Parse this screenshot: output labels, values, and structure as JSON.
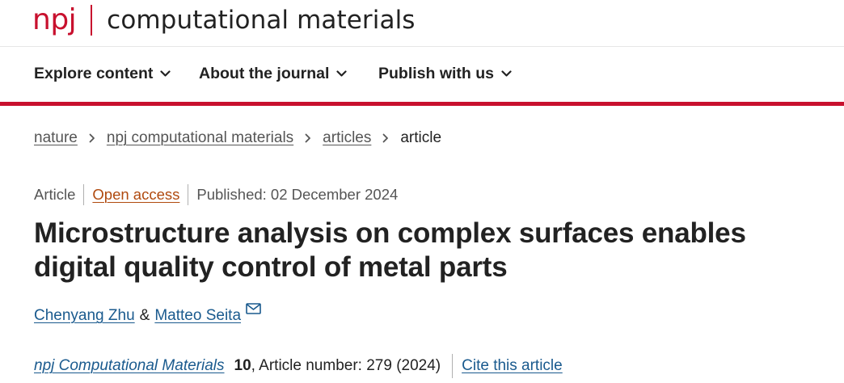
{
  "header": {
    "brand_short": "npj",
    "journal_name": "computational materials"
  },
  "nav": {
    "items": [
      {
        "label": "Explore content"
      },
      {
        "label": "About the journal"
      },
      {
        "label": "Publish with us"
      }
    ]
  },
  "breadcrumb": {
    "items": [
      {
        "label": "nature"
      },
      {
        "label": "npj computational materials"
      },
      {
        "label": "articles"
      }
    ],
    "current": "article"
  },
  "article": {
    "type": "Article",
    "access": "Open access",
    "published": "Published: 02 December 2024",
    "title": "Microstructure analysis on complex surfaces enables digital quality control of metal parts",
    "authors": [
      {
        "name": "Chenyang Zhu"
      },
      {
        "name": "Matteo Seita"
      }
    ],
    "author_separator": "&",
    "citation": {
      "journal": "npj Computational Materials",
      "volume": "10",
      "details": ", Article number: 279 (2024)",
      "cite_label": "Cite this article"
    }
  },
  "colors": {
    "brand_red": "#c8102e",
    "link_blue": "#1a5a8e",
    "open_access": "#b04a0f"
  },
  "icons": {
    "nav_chevron": "chevron-down-icon",
    "crumb_chevron": "chevron-right-icon",
    "author_contact": "mail-icon"
  }
}
